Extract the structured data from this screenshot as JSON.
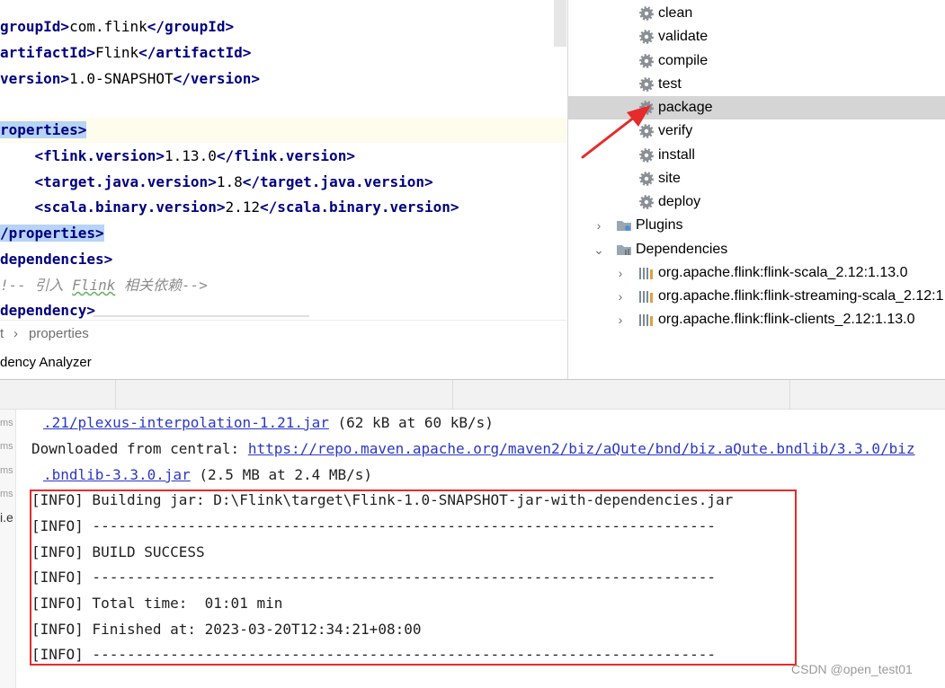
{
  "editor": {
    "lines": {
      "group_open": "groupId>",
      "group_value": "com.flink",
      "group_close": "</groupId>",
      "artifact_open": "artifactId>",
      "artifact_value": "Flink",
      "artifact_close": "</artifactId>",
      "version_open": "version>",
      "version_value": "1.0-SNAPSHOT",
      "version_close": "</version>",
      "properties_open": "roperties>",
      "flink_version_open": "<flink.version>",
      "flink_version_value": "1.13.0",
      "flink_version_close": "</flink.version>",
      "target_java_open": "<target.java.version>",
      "target_java_value": "1.8",
      "target_java_close": "</target.java.version>",
      "scala_binary_open": "<scala.binary.version>",
      "scala_binary_value": "2.12",
      "scala_binary_close": "</scala.binary.version>",
      "properties_close": "/properties>",
      "dependencies_open": "dependencies>",
      "comment_start": "!-- 引入 ",
      "comment_word": "Flink",
      "comment_end": " 相关依赖-->",
      "dependency_open": "dependency>"
    },
    "breadcrumb": {
      "parent": "t",
      "separator": "›",
      "current": "properties"
    },
    "analyzer_label": "dency Analyzer"
  },
  "maven": {
    "lifecycle": [
      "clean",
      "validate",
      "compile",
      "test",
      "package",
      "verify",
      "install",
      "site",
      "deploy"
    ],
    "selected_phase": "package",
    "plugins_label": "Plugins",
    "dependencies_label": "Dependencies",
    "dependencies": [
      "org.apache.flink:flink-scala_2.12:1.13.0",
      "org.apache.flink:flink-streaming-scala_2.12:1",
      "org.apache.flink:flink-clients_2.12:1.13.0"
    ]
  },
  "console": {
    "gutter": [
      "ms",
      "ms",
      "ms",
      "ms",
      "i.e"
    ],
    "line1_link": ".21/plexus-interpolation-1.21.jar",
    "line1_rest": " (62 kB at 60 kB/s)",
    "line2_prefix": "Downloaded from central: ",
    "line2_link": "https://repo.maven.apache.org/maven2/biz/aQute/bnd/biz.aQute.bndlib/3.3.0/biz",
    "line3_link": ".bndlib-3.3.0.jar",
    "line3_rest": " (2.5 MB at 2.4 MB/s)",
    "info_lines": [
      "[INFO] Building jar: D:\\Flink\\target\\Flink-1.0-SNAPSHOT-jar-with-dependencies.jar",
      "[INFO] ------------------------------------------------------------------------",
      "[INFO] BUILD SUCCESS",
      "[INFO] ------------------------------------------------------------------------",
      "[INFO] Total time:  01:01 min",
      "[INFO] Finished at: 2023-03-20T12:34:21+08:00",
      "[INFO] ------------------------------------------------------------------------"
    ]
  },
  "watermark": "CSDN @open_test01",
  "colors": {
    "annotation_red": "#e52b2b",
    "link_blue": "#2a37c7",
    "tag_navy": "#000080",
    "selection_gray": "#d5d5d5"
  }
}
